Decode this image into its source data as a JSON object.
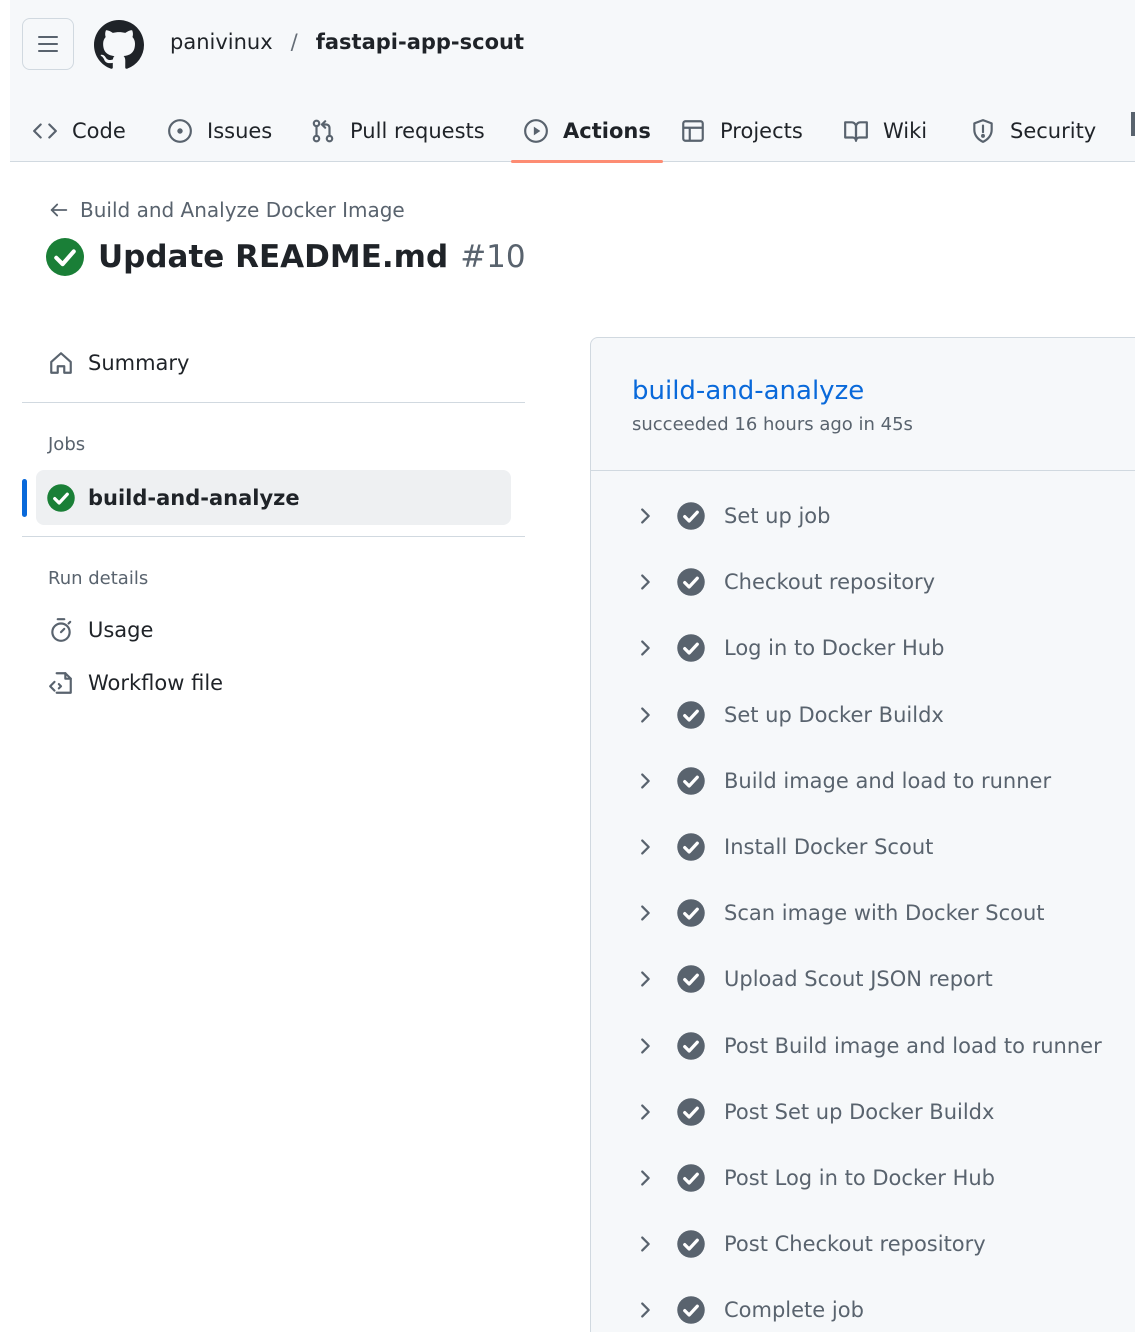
{
  "header": {
    "owner": "panivinux",
    "separator": "/",
    "repo": "fastapi-app-scout",
    "tabs": [
      {
        "label": "Code",
        "icon": "code-icon"
      },
      {
        "label": "Issues",
        "icon": "issue-icon"
      },
      {
        "label": "Pull requests",
        "icon": "pull-request-icon"
      },
      {
        "label": "Actions",
        "icon": "play-icon",
        "active": true
      },
      {
        "label": "Projects",
        "icon": "table-icon"
      },
      {
        "label": "Wiki",
        "icon": "book-icon"
      },
      {
        "label": "Security",
        "icon": "shield-icon"
      }
    ]
  },
  "run": {
    "workflow_name": "Build and Analyze Docker Image",
    "title": "Update README.md",
    "number": "#10",
    "status": "success"
  },
  "sidebar": {
    "summary_label": "Summary",
    "jobs_heading": "Jobs",
    "jobs": [
      {
        "label": "build-and-analyze",
        "status": "success"
      }
    ],
    "run_details_heading": "Run details",
    "usage_label": "Usage",
    "workflow_file_label": "Workflow file"
  },
  "job": {
    "name": "build-and-analyze",
    "meta": "succeeded 16 hours ago in 45s",
    "steps": [
      "Set up job",
      "Checkout repository",
      "Log in to Docker Hub",
      "Set up Docker Buildx",
      "Build image and load to runner",
      "Install Docker Scout",
      "Scan image with Docker Scout",
      "Upload Scout JSON report",
      "Post Build image and load to runner",
      "Post Set up Docker Buildx",
      "Post Log in to Docker Hub",
      "Post Checkout repository",
      "Complete job"
    ]
  },
  "colors": {
    "accent": "#0969da",
    "success": "#1a7f37",
    "active_tab_underline": "#fd8c73",
    "step_check": "#59636e"
  }
}
